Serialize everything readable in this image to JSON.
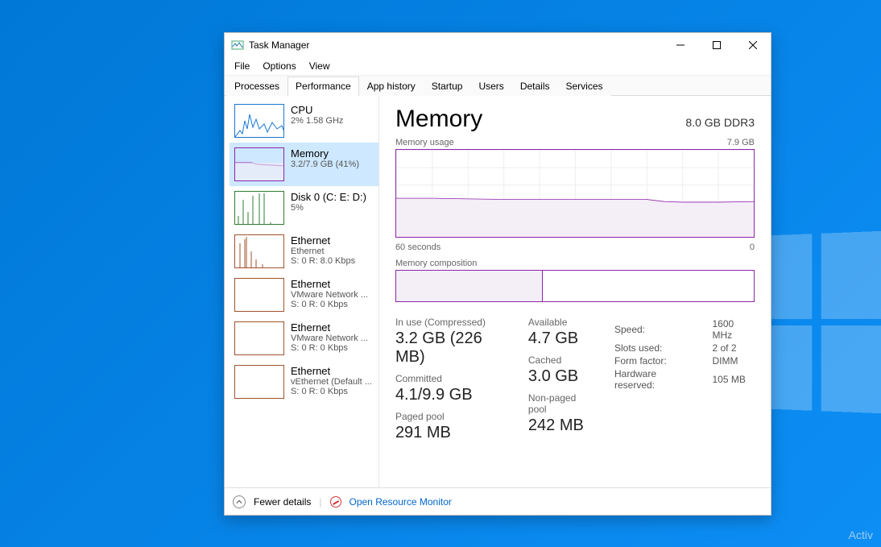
{
  "window": {
    "title": "Task Manager",
    "menu": [
      "File",
      "Options",
      "View"
    ],
    "tabs": [
      "Processes",
      "Performance",
      "App history",
      "Startup",
      "Users",
      "Details",
      "Services"
    ],
    "active_tab": 1
  },
  "sidebar": [
    {
      "kind": "cpu",
      "name": "CPU",
      "sub": "2% 1.58 GHz",
      "sub2": "",
      "selected": false
    },
    {
      "kind": "mem",
      "name": "Memory",
      "sub": "3.2/7.9 GB (41%)",
      "sub2": "",
      "selected": true
    },
    {
      "kind": "disk",
      "name": "Disk 0 (C: E: D:)",
      "sub": "5%",
      "sub2": "",
      "selected": false
    },
    {
      "kind": "eth",
      "name": "Ethernet",
      "sub": "Ethernet",
      "sub2": "S: 0 R: 8.0 Kbps",
      "selected": false
    },
    {
      "kind": "eth",
      "name": "Ethernet",
      "sub": "VMware Network ...",
      "sub2": "S: 0 R: 0 Kbps",
      "selected": false
    },
    {
      "kind": "eth",
      "name": "Ethernet",
      "sub": "VMware Network ...",
      "sub2": "S: 0 R: 0 Kbps",
      "selected": false
    },
    {
      "kind": "eth",
      "name": "Ethernet",
      "sub": "vEthernet (Default ...",
      "sub2": "S: 0 R: 0 Kbps",
      "selected": false
    }
  ],
  "panel": {
    "title": "Memory",
    "right_info": "8.0 GB DDR3",
    "usage_chart_label_left": "Memory usage",
    "usage_chart_label_right": "7.9 GB",
    "usage_x_left": "60 seconds",
    "usage_x_right": "0",
    "composition_label": "Memory composition",
    "composition_used_pct": 41,
    "stats_left": [
      {
        "lbl": "In use (Compressed)",
        "val": "3.2 GB (226 MB)"
      },
      {
        "lbl": "Committed",
        "val": "4.1/9.9 GB"
      },
      {
        "lbl": "Paged pool",
        "val": "291 MB"
      }
    ],
    "stats_left_col2": [
      {
        "lbl": "Available",
        "val": "4.7 GB"
      },
      {
        "lbl": "Cached",
        "val": "3.0 GB"
      },
      {
        "lbl": "Non-paged pool",
        "val": "242 MB"
      }
    ],
    "stats_right": [
      {
        "k": "Speed:",
        "v": "1600 MHz"
      },
      {
        "k": "Slots used:",
        "v": "2 of 2"
      },
      {
        "k": "Form factor:",
        "v": "DIMM"
      },
      {
        "k": "Hardware reserved:",
        "v": "105 MB"
      }
    ]
  },
  "footer": {
    "fewer_details": "Fewer details",
    "resource_monitor": "Open Resource Monitor"
  },
  "watermark": "Activ",
  "chart_data": {
    "type": "line",
    "title": "Memory usage",
    "ylabel": "GB",
    "ylim": [
      0,
      7.9
    ],
    "xlabel_left": "60 seconds",
    "xlabel_right": "0",
    "x": [
      0,
      6,
      12,
      18,
      24,
      30,
      36,
      42,
      45,
      48,
      54,
      60
    ],
    "values": [
      3.5,
      3.5,
      3.45,
      3.4,
      3.4,
      3.4,
      3.4,
      3.4,
      3.2,
      3.15,
      3.15,
      3.2
    ],
    "series_color": "#8e24aa",
    "fill_color": "#f4eef7"
  }
}
